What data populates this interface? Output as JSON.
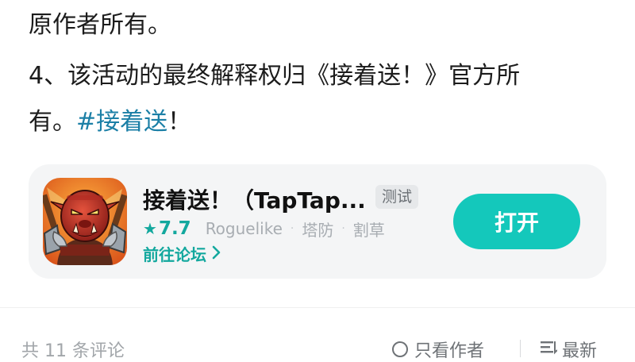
{
  "post": {
    "line1": "原作者所有。",
    "line2": "4、该活动的最终解释权归《接着送！》官方所",
    "line3_prefix": "有。",
    "hashtag": "#接着送",
    "line3_suffix": "！"
  },
  "app_card": {
    "name": "接着送！（TapTap...",
    "badge": "测试",
    "rating_star": "★",
    "rating": "7.7",
    "tags": [
      "Roguelike",
      "塔防",
      "割草"
    ],
    "separator": "·",
    "forum_link": "前往论坛",
    "open_button": "打开",
    "icon": "app-icon-orc-warrior"
  },
  "comments_bar": {
    "count_text": "共 11 条评论",
    "author_only": "只看作者",
    "sort": "最新"
  },
  "colors": {
    "accent": "#14c8bb",
    "accent_text": "#13a89e",
    "hashtag": "#1b7fa6",
    "card_bg": "#f4f5f6"
  }
}
